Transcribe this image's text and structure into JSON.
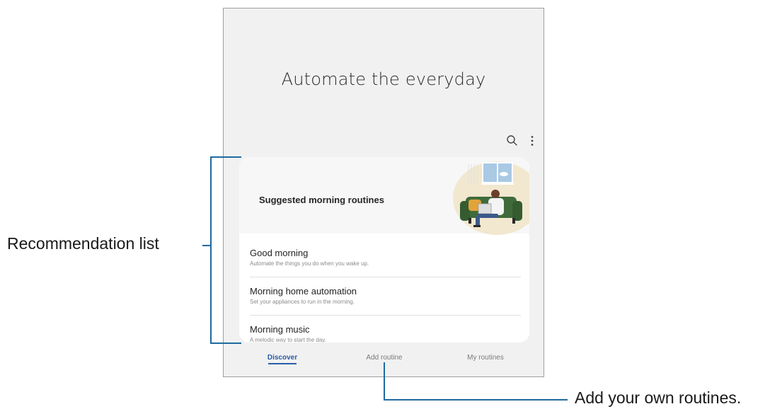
{
  "hero": {
    "title": "Automate the everyday"
  },
  "toolbar": {
    "search_icon": "search-icon",
    "more_icon": "more-vertical-icon"
  },
  "card": {
    "title": "Suggested morning routines",
    "illustration": "person-reading-on-couch-illustration",
    "items": [
      {
        "title": "Good morning",
        "subtitle": "Automate the things you do when you wake up."
      },
      {
        "title": "Morning home automation",
        "subtitle": "Set your appliances to run in the morning."
      },
      {
        "title": "Morning music",
        "subtitle": "A melodic way to start the day."
      }
    ]
  },
  "tabs": [
    {
      "label": "Discover",
      "active": true
    },
    {
      "label": "Add routine",
      "active": false
    },
    {
      "label": "My routines",
      "active": false
    }
  ],
  "callouts": {
    "recommendation": "Recommendation list",
    "add_routines": "Add your own routines."
  },
  "colors": {
    "accent": "#2a5caa",
    "callout_line": "#1f6aa0",
    "screen_bg": "#f1f1f1"
  }
}
